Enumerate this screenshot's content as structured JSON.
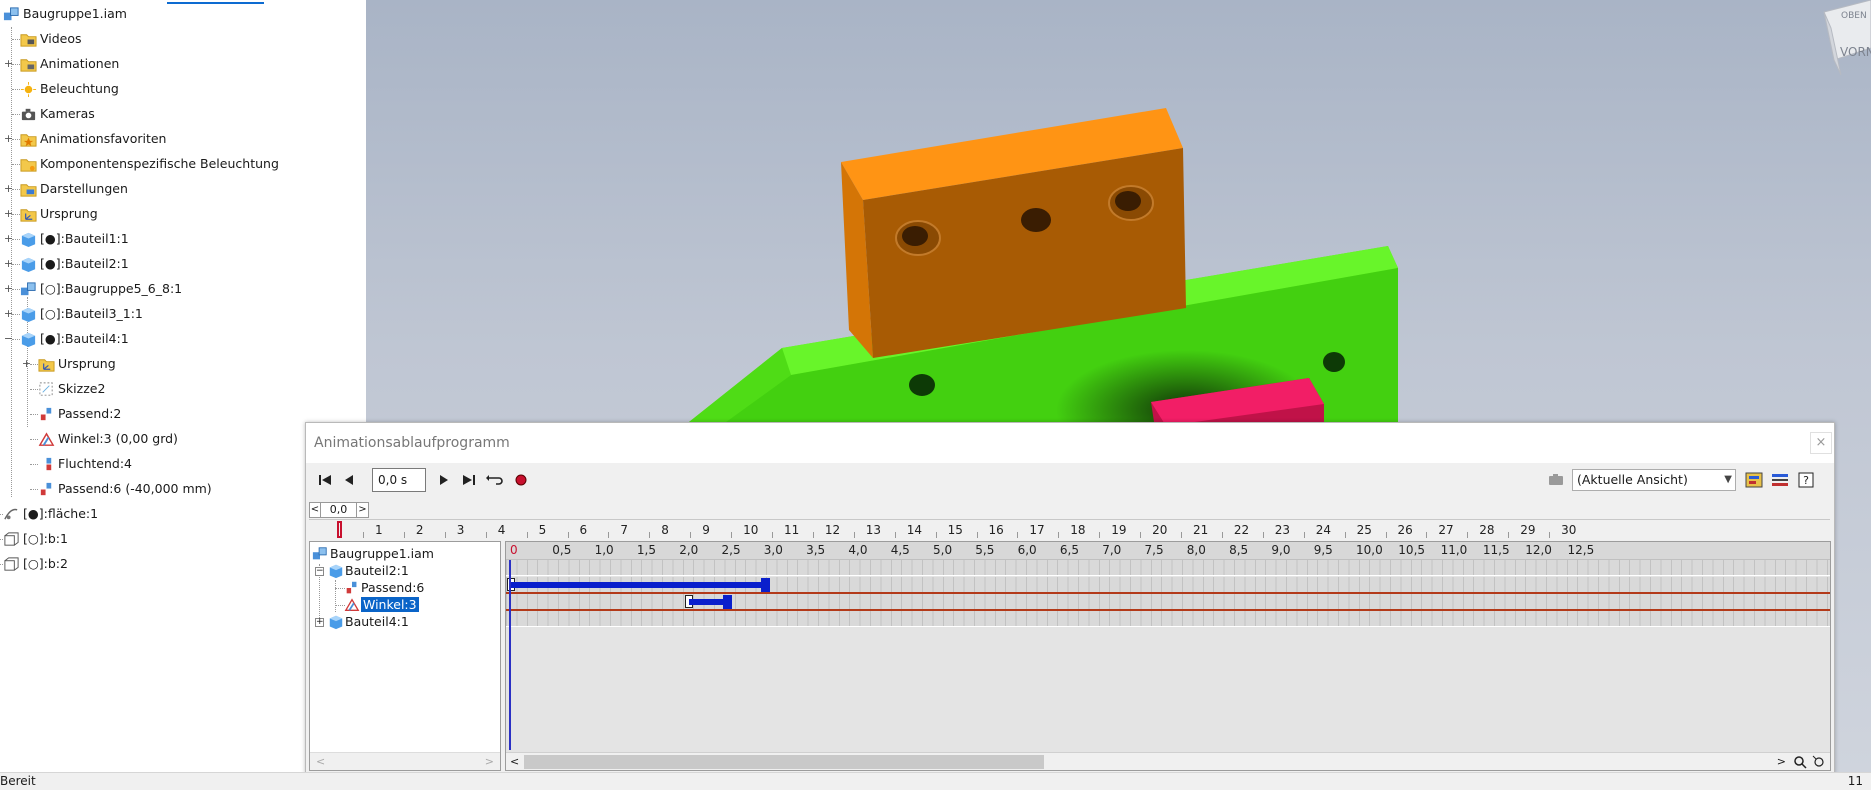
{
  "browser": {
    "items": [
      {
        "label": "Baugruppe1.iam",
        "icon": "assembly-icon"
      },
      {
        "label": "Videos",
        "icon": "folder-videos-icon"
      },
      {
        "label": "Animationen",
        "icon": "folder-animation-icon"
      },
      {
        "label": "Beleuchtung",
        "icon": "sun-icon"
      },
      {
        "label": "Kameras",
        "icon": "camera-icon"
      },
      {
        "label": "Animationsfavoriten",
        "icon": "folder-star-icon"
      },
      {
        "label": "Komponentenspezifische Beleuchtung",
        "icon": "folder-light-icon"
      },
      {
        "label": "Darstellungen",
        "icon": "folder-views-icon"
      },
      {
        "label": "Ursprung",
        "icon": "folder-origin-icon"
      },
      {
        "label": "[●]:Bauteil1:1",
        "icon": "part-icon"
      },
      {
        "label": "[●]:Bauteil2:1",
        "icon": "part-icon"
      },
      {
        "label": "[○]:Baugruppe5_6_8:1",
        "icon": "subassembly-icon"
      },
      {
        "label": "[○]:Bauteil3_1:1",
        "icon": "part-icon"
      },
      {
        "label": "[●]:Bauteil4:1",
        "icon": "part-icon"
      },
      {
        "label": "Ursprung",
        "icon": "folder-origin-icon"
      },
      {
        "label": "Skizze2",
        "icon": "sketch-icon"
      },
      {
        "label": "Passend:2",
        "icon": "mate-constraint-icon"
      },
      {
        "label": "Winkel:3 (0,00 grd)",
        "icon": "angle-constraint-icon"
      },
      {
        "label": "Fluchtend:4",
        "icon": "flush-constraint-icon"
      },
      {
        "label": "Passend:6 (-40,000 mm)",
        "icon": "mate-constraint-icon"
      },
      {
        "label": "[●]:fläche:1",
        "icon": "surface-icon"
      },
      {
        "label": "[○]:b:1",
        "icon": "wireframe-part-icon"
      },
      {
        "label": "[○]:b:2",
        "icon": "wireframe-part-icon"
      }
    ]
  },
  "viewcube": {
    "top": "OBEN",
    "front": "VORN"
  },
  "dialog": {
    "title": "Animationsablaufprogramm",
    "close": "×",
    "time_value": "0,0 s",
    "view_select": "(Aktuelle Ansicht)",
    "ruler_value": "0,0",
    "ruler_ticks": [
      "1",
      "2",
      "3",
      "4",
      "5",
      "6",
      "7",
      "8",
      "9",
      "10",
      "11",
      "12",
      "13",
      "14",
      "15",
      "16",
      "17",
      "18",
      "19",
      "20",
      "21",
      "22",
      "23",
      "24",
      "25",
      "26",
      "27",
      "28",
      "29",
      "30"
    ],
    "tree": {
      "root": "Baugruppe1.iam",
      "part2": "Bauteil2:1",
      "passend6": "Passend:6",
      "winkel3": "Winkel:3",
      "part4": "Bauteil4:1"
    },
    "timeline_ticks": [
      "0",
      "0,5",
      "1,0",
      "1,5",
      "2,0",
      "2,5",
      "3,0",
      "3,5",
      "4,0",
      "4,5",
      "5,0",
      "5,5",
      "6,0",
      "6,5",
      "7,0",
      "7,5",
      "8,0",
      "8,5",
      "9,0",
      "9,5",
      "10,0",
      "10,5",
      "11,0",
      "11,5",
      "12,0",
      "12,5"
    ],
    "actions": {
      "passend6": {
        "start": 0.0,
        "end": 3.0
      },
      "winkel3": {
        "start": 2.1,
        "end": 2.55
      }
    }
  },
  "status": {
    "text": "Bereit",
    "right": "11"
  },
  "colors": {
    "accent": "#0a64c8",
    "timeline_bar": "#0a1fcc",
    "orange_part": "#ff8c00",
    "green_part": "#55e81a",
    "pink_part": "#e81a5a"
  }
}
